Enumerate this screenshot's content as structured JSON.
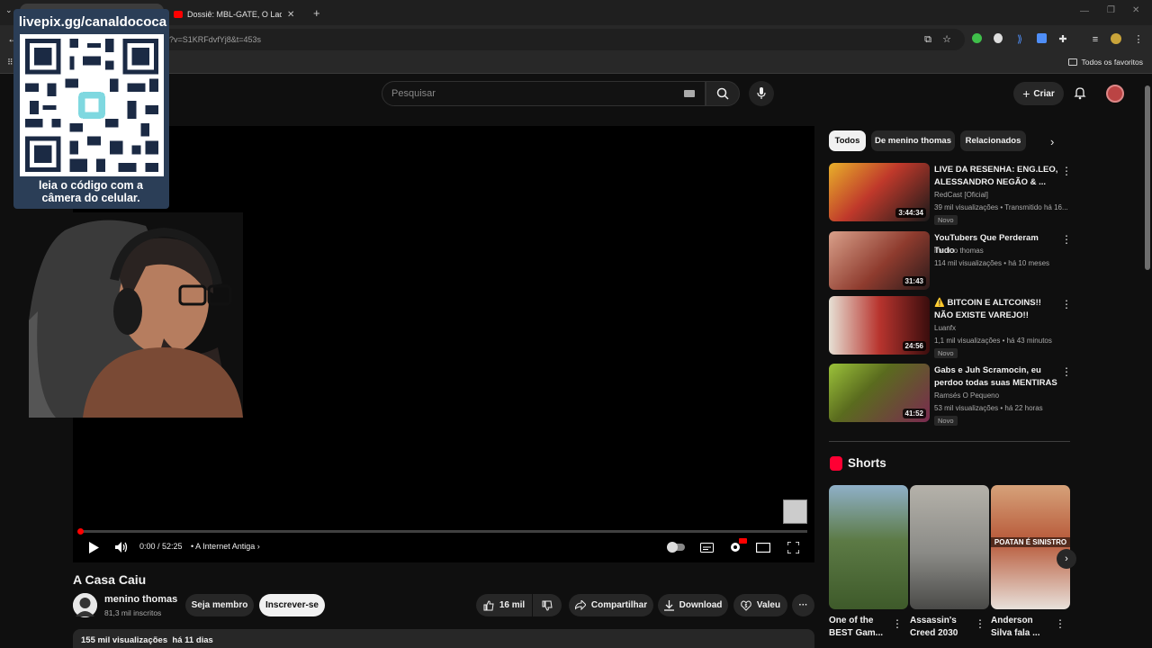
{
  "browser": {
    "tabs": [
      {
        "label": ""
      },
      {
        "label": "Dossiê: MBL-GATE, O Lado Obs..."
      }
    ],
    "url": "?v=S1KRFdvfYj8&t=453s",
    "bookmarks_all": "Todos os favoritos"
  },
  "overlay": {
    "url": "livepix.gg/canaldococa",
    "caption_line1": "leia o código com a",
    "caption_line2": "câmera do celular."
  },
  "masthead": {
    "search_placeholder": "Pesquisar",
    "create_label": "Criar"
  },
  "player": {
    "time": "0:00 / 52:25",
    "chapter": "A Internet Antiga",
    "progress": 0.0
  },
  "video": {
    "title": "A Casa Caiu",
    "channel": "menino thomas",
    "subscribers": "81,3 mil inscritos",
    "join_label": "Seja membro",
    "subscribe_label": "Inscrever-se",
    "likes": "16 mil",
    "share_label": "Compartilhar",
    "download_label": "Download",
    "thanks_label": "Valeu",
    "views": "155 mil visualizações",
    "age": "há 11 dias"
  },
  "sidebar": {
    "chips": [
      "Todos",
      "De menino thomas",
      "Relacionados"
    ],
    "recommendations": [
      {
        "title": "LIVE DA RESENHA: ENG.LEO, ALESSANDRO NEGÃO & ...",
        "channel": "RedCast [Oficial]",
        "meta": "39 mil visualizações • Transmitido há 16...",
        "duration": "3:44:34",
        "badge": "Novo",
        "color": "#c0392b"
      },
      {
        "title": "YouTubers Que Perderam Tudo",
        "channel": "menino thomas",
        "meta": "114 mil visualizações • há 10 meses",
        "duration": "31:43",
        "badge": "",
        "color": "#8e3b2e"
      },
      {
        "title": "⚠️ BITCOIN E ALTCOINS!! NÃO EXISTE VAREJO!! ENTENDA A ...",
        "channel": "Luanfx",
        "meta": "1,1 mil visualizações • há 43 minutos",
        "duration": "24:56",
        "badge": "Novo",
        "color": "#7a1d1d"
      },
      {
        "title": "Gabs e Juh Scramocin, eu perdoo todas suas MENTIRAS ...",
        "channel": "Ramsés O Pequeno",
        "meta": "53 mil visualizações • há 22 horas",
        "duration": "41:52",
        "badge": "Novo",
        "color": "#5a6b1e"
      }
    ],
    "shorts_title": "Shorts",
    "shorts": [
      {
        "title": "One of the BEST Gam...",
        "color": "#5c7a45"
      },
      {
        "title": "Assassin's Creed 2030",
        "color": "#8a8a86"
      },
      {
        "title": "Anderson Silva fala ...",
        "color": "#b85a3a",
        "overlay": "POATAN É SINISTRO"
      }
    ]
  }
}
